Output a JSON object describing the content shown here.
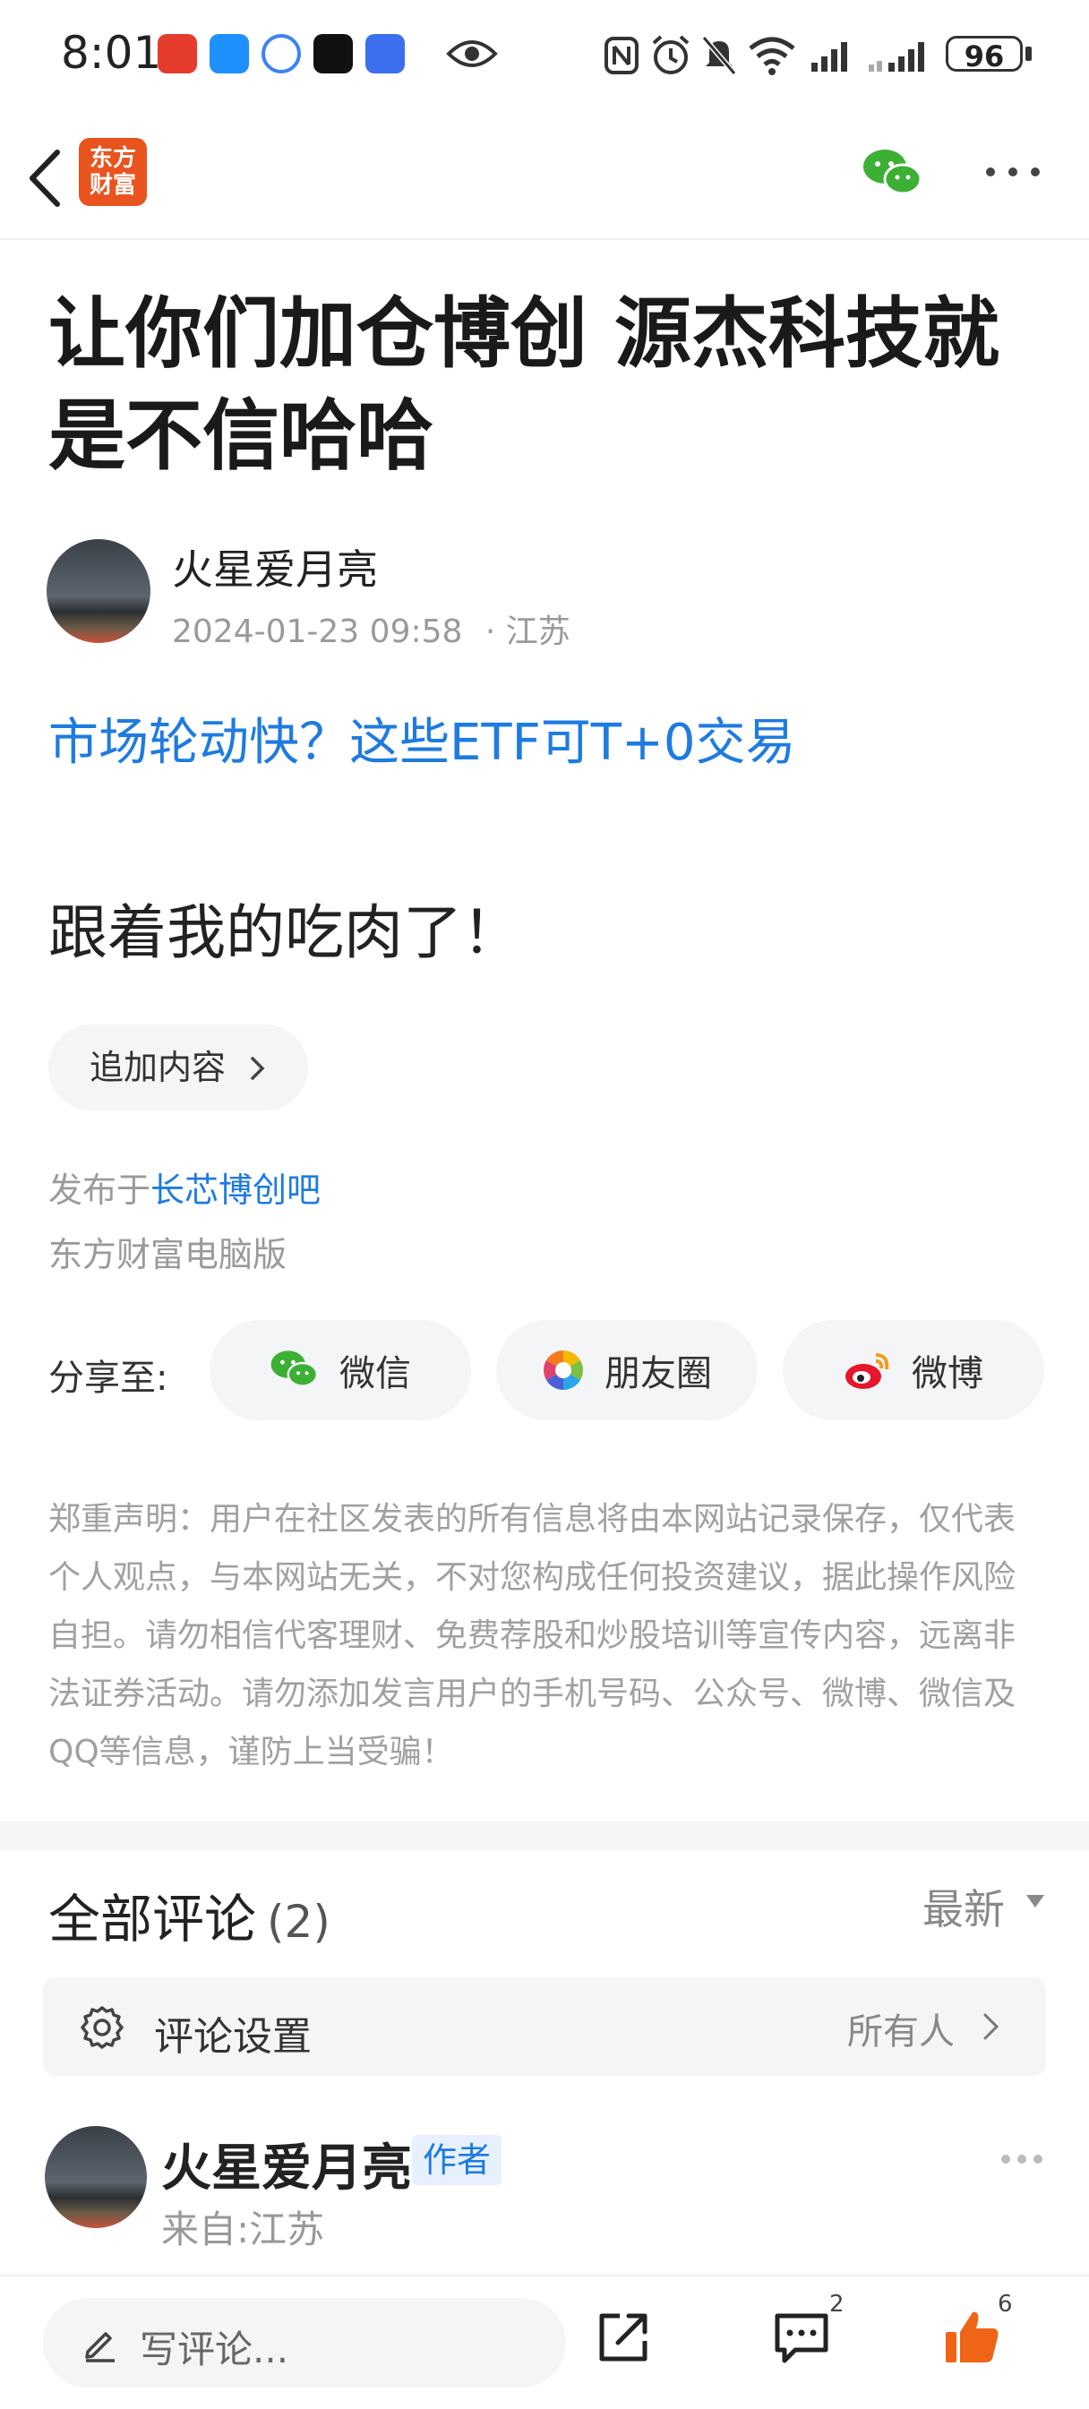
{
  "status_bar": {
    "time": "8:01",
    "battery": "96",
    "app_icons": [
      "c-app-icon",
      "message-app-icon",
      "browser-app-icon",
      "tiktok-app-icon",
      "navigation-app-icon",
      "eye-icon"
    ],
    "system_icons": [
      "nfc-icon",
      "alarm-icon",
      "mute-icon",
      "wifi-icon",
      "signal-icon",
      "signal-icon-2"
    ]
  },
  "header": {
    "logo_line1": "东方",
    "logo_line2": "财富"
  },
  "post": {
    "title": "让你们加仓博创 源杰科技就是不信哈哈",
    "author": "火星爱月亮",
    "datetime": "2024-01-23 09:58",
    "location": "· 江苏",
    "promo_link": "市场轮动快？这些ETF可T+0交易",
    "body": "跟着我的吃肉了！",
    "append_label": "追加内容",
    "posted_prefix": "发布于",
    "bar_name": "长芯博创吧",
    "source": "东方财富电脑版"
  },
  "share": {
    "label": "分享至:",
    "wechat": "微信",
    "moments": "朋友圈",
    "weibo": "微博"
  },
  "disclaimer": "郑重声明：用户在社区发表的所有信息将由本网站记录保存，仅代表个人观点，与本网站无关，不对您构成任何投资建议，据此操作风险自担。请勿相信代客理财、免费荐股和炒股培训等宣传内容，远离非法证券活动。请勿添加发言用户的手机号码、公众号、微博、微信及QQ等信息，谨防上当受骗！",
  "comments": {
    "title": "全部评论",
    "count": "(2)",
    "sort": "最新",
    "settings_label": "评论设置",
    "settings_value": "所有人",
    "first": {
      "author": "火星爱月亮",
      "badge": "作者",
      "location": "来自:江苏"
    }
  },
  "bottom_bar": {
    "placeholder": "写评论...",
    "comment_count": "2",
    "like_count": "6"
  },
  "colors": {
    "link": "#1e7be0",
    "brand": "#e9531d",
    "like": "#f06418",
    "wechat": "#3cb034"
  }
}
